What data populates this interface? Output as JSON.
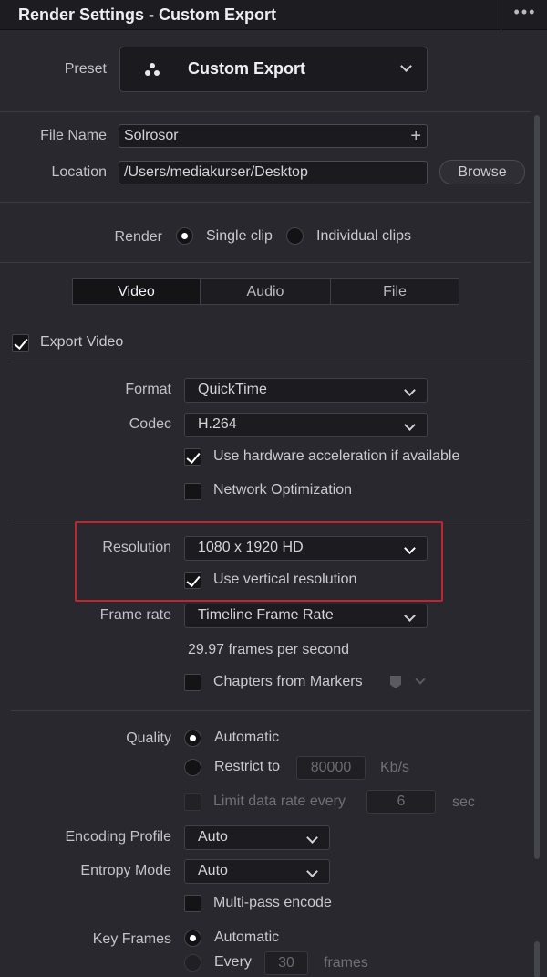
{
  "window": {
    "title": "Render Settings - Custom Export",
    "more_icon": "ellipsis-icon"
  },
  "preset": {
    "label": "Preset",
    "value": "Custom Export",
    "icon": "resolve-logo-icon"
  },
  "file": {
    "name_label": "File Name",
    "name_value": "Solrosor",
    "location_label": "Location",
    "location_value": "/Users/mediakurser/Desktop",
    "browse_label": "Browse"
  },
  "render": {
    "label": "Render",
    "options": [
      "Single clip",
      "Individual clips"
    ],
    "selected": "Single clip"
  },
  "tabs": [
    {
      "label": "Video",
      "active": true
    },
    {
      "label": "Audio",
      "active": false
    },
    {
      "label": "File",
      "active": false
    }
  ],
  "export_video": {
    "label": "Export Video",
    "checked": true
  },
  "format": {
    "label": "Format",
    "value": "QuickTime"
  },
  "codec": {
    "label": "Codec",
    "value": "H.264"
  },
  "hw_accel": {
    "label": "Use hardware acceleration if available",
    "checked": true
  },
  "network_opt": {
    "label": "Network Optimization",
    "checked": false
  },
  "resolution": {
    "label": "Resolution",
    "value": "1080 x 1920 HD"
  },
  "vertical_res": {
    "label": "Use vertical resolution",
    "checked": true
  },
  "frame_rate": {
    "label": "Frame rate",
    "value": "Timeline Frame Rate",
    "note": "29.97 frames per second"
  },
  "chapters": {
    "label": "Chapters from Markers",
    "checked": false
  },
  "quality": {
    "label": "Quality",
    "automatic_label": "Automatic",
    "restrict_label": "Restrict to",
    "restrict_value": "80000",
    "restrict_unit": "Kb/s",
    "limit_label": "Limit data rate every",
    "limit_value": "6",
    "limit_unit": "sec"
  },
  "encoding_profile": {
    "label": "Encoding Profile",
    "value": "Auto"
  },
  "entropy_mode": {
    "label": "Entropy Mode",
    "value": "Auto"
  },
  "multipass": {
    "label": "Multi-pass encode",
    "checked": false
  },
  "key_frames": {
    "label": "Key Frames",
    "automatic_label": "Automatic",
    "every_label": "Every",
    "every_value": "30",
    "every_unit": "frames"
  },
  "colors": {
    "accent_highlight": "#c0262c",
    "background": "#28282e",
    "titlebar": "#1d1d21"
  }
}
